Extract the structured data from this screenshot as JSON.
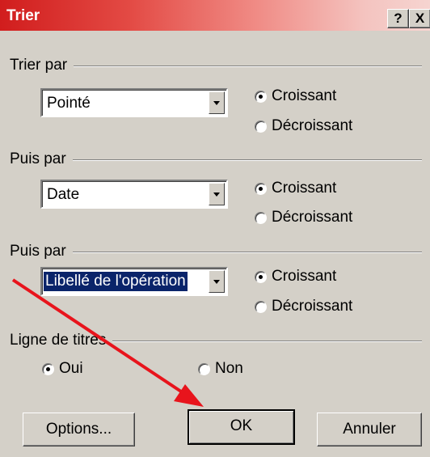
{
  "window": {
    "title": "Trier",
    "help_button": "?",
    "close_button": "X"
  },
  "sort_groups": [
    {
      "label": "Trier par",
      "field": "Pointé",
      "options": [
        "Croissant",
        "Décroissant"
      ],
      "selected": "Croissant"
    },
    {
      "label": "Puis par",
      "field": "Date",
      "options": [
        "Croissant",
        "Décroissant"
      ],
      "selected": "Croissant"
    },
    {
      "label": "Puis par",
      "field": "Libellé de l'opération",
      "options": [
        "Croissant",
        "Décroissant"
      ],
      "selected": "Croissant"
    }
  ],
  "header_row": {
    "label": "Ligne de titres",
    "options": [
      "Oui",
      "Non"
    ],
    "selected": "Oui"
  },
  "buttons": {
    "options": "Options...",
    "ok": "OK",
    "cancel": "Annuler"
  },
  "colors": {
    "annotation_arrow": "#e8141c",
    "title_start": "#d11d1d",
    "selection": "#0a246a"
  }
}
